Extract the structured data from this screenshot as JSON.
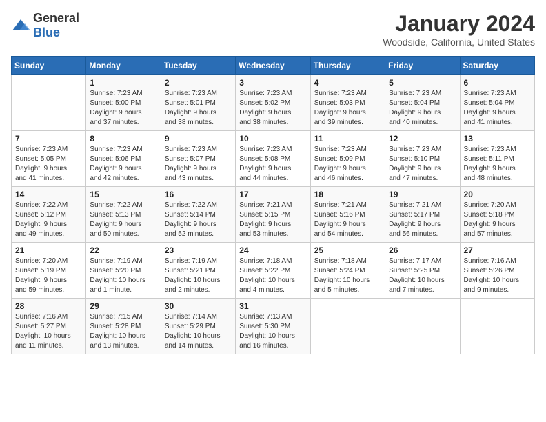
{
  "logo": {
    "general": "General",
    "blue": "Blue"
  },
  "title": "January 2024",
  "location": "Woodside, California, United States",
  "weekdays": [
    "Sunday",
    "Monday",
    "Tuesday",
    "Wednesday",
    "Thursday",
    "Friday",
    "Saturday"
  ],
  "weeks": [
    [
      {
        "day": "",
        "info": ""
      },
      {
        "day": "1",
        "info": "Sunrise: 7:23 AM\nSunset: 5:00 PM\nDaylight: 9 hours\nand 37 minutes."
      },
      {
        "day": "2",
        "info": "Sunrise: 7:23 AM\nSunset: 5:01 PM\nDaylight: 9 hours\nand 38 minutes."
      },
      {
        "day": "3",
        "info": "Sunrise: 7:23 AM\nSunset: 5:02 PM\nDaylight: 9 hours\nand 38 minutes."
      },
      {
        "day": "4",
        "info": "Sunrise: 7:23 AM\nSunset: 5:03 PM\nDaylight: 9 hours\nand 39 minutes."
      },
      {
        "day": "5",
        "info": "Sunrise: 7:23 AM\nSunset: 5:04 PM\nDaylight: 9 hours\nand 40 minutes."
      },
      {
        "day": "6",
        "info": "Sunrise: 7:23 AM\nSunset: 5:04 PM\nDaylight: 9 hours\nand 41 minutes."
      }
    ],
    [
      {
        "day": "7",
        "info": "Sunrise: 7:23 AM\nSunset: 5:05 PM\nDaylight: 9 hours\nand 41 minutes."
      },
      {
        "day": "8",
        "info": "Sunrise: 7:23 AM\nSunset: 5:06 PM\nDaylight: 9 hours\nand 42 minutes."
      },
      {
        "day": "9",
        "info": "Sunrise: 7:23 AM\nSunset: 5:07 PM\nDaylight: 9 hours\nand 43 minutes."
      },
      {
        "day": "10",
        "info": "Sunrise: 7:23 AM\nSunset: 5:08 PM\nDaylight: 9 hours\nand 44 minutes."
      },
      {
        "day": "11",
        "info": "Sunrise: 7:23 AM\nSunset: 5:09 PM\nDaylight: 9 hours\nand 46 minutes."
      },
      {
        "day": "12",
        "info": "Sunrise: 7:23 AM\nSunset: 5:10 PM\nDaylight: 9 hours\nand 47 minutes."
      },
      {
        "day": "13",
        "info": "Sunrise: 7:23 AM\nSunset: 5:11 PM\nDaylight: 9 hours\nand 48 minutes."
      }
    ],
    [
      {
        "day": "14",
        "info": "Sunrise: 7:22 AM\nSunset: 5:12 PM\nDaylight: 9 hours\nand 49 minutes."
      },
      {
        "day": "15",
        "info": "Sunrise: 7:22 AM\nSunset: 5:13 PM\nDaylight: 9 hours\nand 50 minutes."
      },
      {
        "day": "16",
        "info": "Sunrise: 7:22 AM\nSunset: 5:14 PM\nDaylight: 9 hours\nand 52 minutes."
      },
      {
        "day": "17",
        "info": "Sunrise: 7:21 AM\nSunset: 5:15 PM\nDaylight: 9 hours\nand 53 minutes."
      },
      {
        "day": "18",
        "info": "Sunrise: 7:21 AM\nSunset: 5:16 PM\nDaylight: 9 hours\nand 54 minutes."
      },
      {
        "day": "19",
        "info": "Sunrise: 7:21 AM\nSunset: 5:17 PM\nDaylight: 9 hours\nand 56 minutes."
      },
      {
        "day": "20",
        "info": "Sunrise: 7:20 AM\nSunset: 5:18 PM\nDaylight: 9 hours\nand 57 minutes."
      }
    ],
    [
      {
        "day": "21",
        "info": "Sunrise: 7:20 AM\nSunset: 5:19 PM\nDaylight: 9 hours\nand 59 minutes."
      },
      {
        "day": "22",
        "info": "Sunrise: 7:19 AM\nSunset: 5:20 PM\nDaylight: 10 hours\nand 1 minute."
      },
      {
        "day": "23",
        "info": "Sunrise: 7:19 AM\nSunset: 5:21 PM\nDaylight: 10 hours\nand 2 minutes."
      },
      {
        "day": "24",
        "info": "Sunrise: 7:18 AM\nSunset: 5:22 PM\nDaylight: 10 hours\nand 4 minutes."
      },
      {
        "day": "25",
        "info": "Sunrise: 7:18 AM\nSunset: 5:24 PM\nDaylight: 10 hours\nand 5 minutes."
      },
      {
        "day": "26",
        "info": "Sunrise: 7:17 AM\nSunset: 5:25 PM\nDaylight: 10 hours\nand 7 minutes."
      },
      {
        "day": "27",
        "info": "Sunrise: 7:16 AM\nSunset: 5:26 PM\nDaylight: 10 hours\nand 9 minutes."
      }
    ],
    [
      {
        "day": "28",
        "info": "Sunrise: 7:16 AM\nSunset: 5:27 PM\nDaylight: 10 hours\nand 11 minutes."
      },
      {
        "day": "29",
        "info": "Sunrise: 7:15 AM\nSunset: 5:28 PM\nDaylight: 10 hours\nand 13 minutes."
      },
      {
        "day": "30",
        "info": "Sunrise: 7:14 AM\nSunset: 5:29 PM\nDaylight: 10 hours\nand 14 minutes."
      },
      {
        "day": "31",
        "info": "Sunrise: 7:13 AM\nSunset: 5:30 PM\nDaylight: 10 hours\nand 16 minutes."
      },
      {
        "day": "",
        "info": ""
      },
      {
        "day": "",
        "info": ""
      },
      {
        "day": "",
        "info": ""
      }
    ]
  ]
}
